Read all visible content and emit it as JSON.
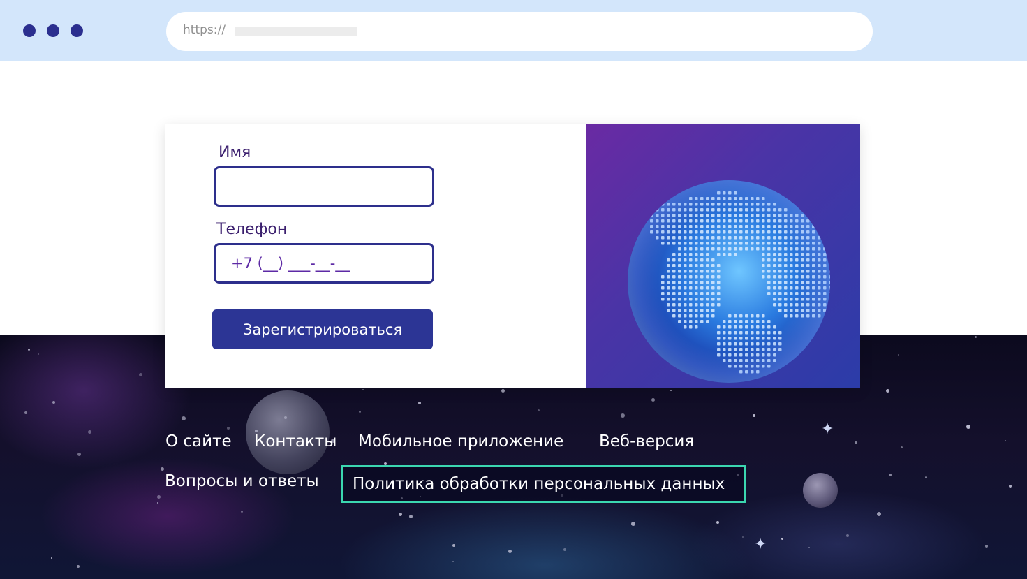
{
  "browser": {
    "url_scheme": "https://"
  },
  "form": {
    "name_label": "Имя",
    "name_value": "",
    "phone_label": "Телефон",
    "phone_placeholder": "+7 (__) ___-__-__",
    "submit_label": "Зарегистрироваться"
  },
  "footer": {
    "links": [
      {
        "label": "О сайте"
      },
      {
        "label": "Контакты"
      },
      {
        "label": "Мобильное приложение"
      },
      {
        "label": "Веб-версия"
      },
      {
        "label": "Вопросы и ответы"
      },
      {
        "label": "Политика обработки персональных данных"
      }
    ]
  },
  "colors": {
    "chrome_bg": "#d3e6fb",
    "dots": "#2b2f8f",
    "accent": "#2c3595",
    "label_text": "#3b1f6e",
    "highlight_border": "#3bd7b0"
  },
  "icons": [
    "window-dot-icon",
    "globe-illustration"
  ]
}
